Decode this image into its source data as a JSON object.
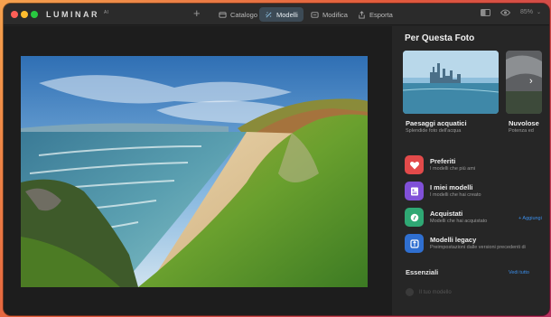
{
  "app": {
    "name": "LUMINAR",
    "version": "AI"
  },
  "toolbar": {
    "add_label": "+",
    "tabs": [
      {
        "label": "Catalogo",
        "icon": "catalog-icon"
      },
      {
        "label": "Modelli",
        "icon": "templates-icon",
        "active": true
      },
      {
        "label": "Modifica",
        "icon": "edit-icon"
      },
      {
        "label": "Esporta",
        "icon": "export-icon"
      }
    ],
    "zoom": "85%"
  },
  "panel": {
    "title": "Per Questa Foto",
    "cards": [
      {
        "title": "Paesaggi acquatici",
        "subtitle": "Splendide foto dell'acqua"
      },
      {
        "title": "Nuvolose",
        "subtitle": "Potenza ed"
      }
    ],
    "collections": [
      {
        "title": "Preferiti",
        "subtitle": "I modelli che più ami",
        "icon": "heart-icon",
        "color": "#e24a4a"
      },
      {
        "title": "I miei modelli",
        "subtitle": "I modelli che hai creato",
        "icon": "user-templates-icon",
        "color": "#8050d8"
      },
      {
        "title": "Acquistati",
        "subtitle": "Modelli che hai acquistato",
        "icon": "purchased-icon",
        "color": "#2fa874",
        "action": "+ Aggiungi"
      },
      {
        "title": "Modelli legacy",
        "subtitle": "Preimpostazioni dalle versioni precedenti di",
        "icon": "legacy-icon",
        "color": "#2f6fd0"
      }
    ],
    "essentials_title": "Essenziali",
    "see_all": "Vedi tutto",
    "faded_item": "Il tuo modello"
  }
}
